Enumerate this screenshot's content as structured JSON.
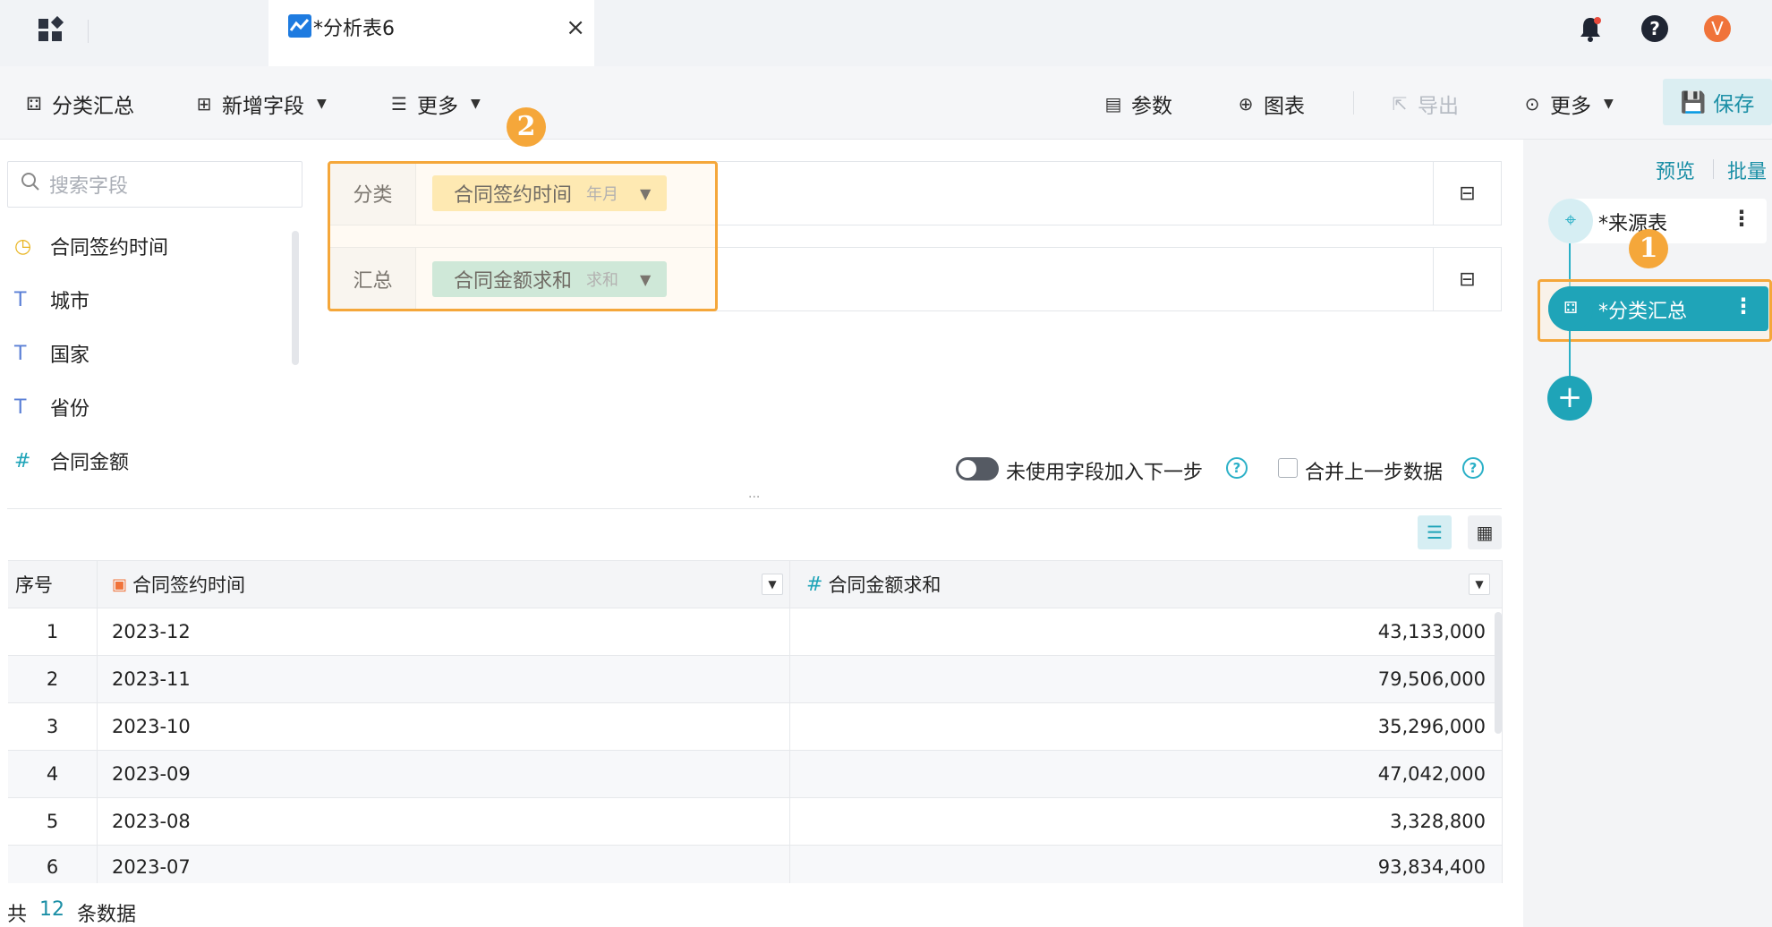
{
  "tab": {
    "title": "*分析表6",
    "close": "×"
  },
  "top_icons": {
    "bell": "bell-icon",
    "help": "?",
    "avatar": "V"
  },
  "toolbar": {
    "group_summary": "分类汇总",
    "new_field": "新增字段",
    "more_left": "更多",
    "params": "参数",
    "chart": "图表",
    "export": "导出",
    "more_right": "更多",
    "save": "保存"
  },
  "search": {
    "placeholder": "搜索字段"
  },
  "fields": [
    {
      "label": "合同签约时间",
      "icon": "calendar-clock-icon"
    },
    {
      "label": "城市",
      "icon": "T"
    },
    {
      "label": "国家",
      "icon": "T"
    },
    {
      "label": "省份",
      "icon": "T"
    },
    {
      "label": "合同金额",
      "icon": "#"
    }
  ],
  "config": {
    "group_label": "分类",
    "group_chip": "合同签约时间",
    "group_chip_sub": "年月",
    "sum_label": "汇总",
    "sum_chip": "合同金额求和",
    "sum_chip_sub": "求和"
  },
  "badges": {
    "one": "1",
    "two": "2"
  },
  "options": {
    "unused_fields": "未使用字段加入下一步",
    "merge_prev": "合并上一步数据",
    "dots": "..."
  },
  "table": {
    "headers": [
      "序号",
      "合同签约时间",
      "合同金额求和"
    ],
    "rows": [
      [
        "1",
        "2023-12",
        "43,133,000"
      ],
      [
        "2",
        "2023-11",
        "79,506,000"
      ],
      [
        "3",
        "2023-10",
        "35,296,000"
      ],
      [
        "4",
        "2023-09",
        "47,042,000"
      ],
      [
        "5",
        "2023-08",
        "3,328,800"
      ],
      [
        "6",
        "2023-07",
        "93,834,400"
      ]
    ]
  },
  "footer": {
    "prefix": "共",
    "count": "12",
    "suffix": "条数据"
  },
  "right_panel": {
    "preview": "预览",
    "batch": "批量",
    "source_node": "*来源表",
    "summary_node": "*分类汇总",
    "add": "+"
  },
  "colors": {
    "accent": "#1fa4b8",
    "highlight": "#f5a73a",
    "chip_group": "#fde59c",
    "chip_sum": "#b5e3d6"
  }
}
